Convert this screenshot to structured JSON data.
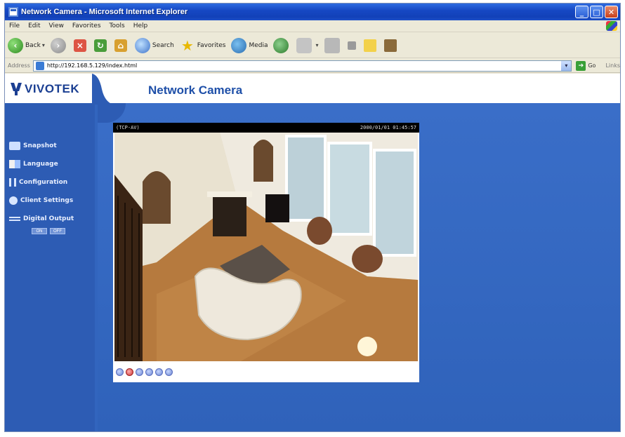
{
  "window": {
    "title": "Network Camera - Microsoft Internet Explorer",
    "buttons": [
      "minimize-button",
      "maximize-button",
      "close-button"
    ]
  },
  "menubar": {
    "items": [
      "File",
      "Edit",
      "View",
      "Favorites",
      "Tools",
      "Help"
    ]
  },
  "toolbar": {
    "back_label": "Back",
    "search_label": "Search",
    "favorites_label": "Favorites",
    "media_label": "Media"
  },
  "addressbar": {
    "label": "Address",
    "url": "http://192.168.5.129/index.html",
    "go_label": "Go",
    "links_label": "Links"
  },
  "page": {
    "logo": "VIVOTEK",
    "title": "Network Camera"
  },
  "sidebar": {
    "items": [
      {
        "label": "Snapshot",
        "icon": "camera-icon"
      },
      {
        "label": "Language",
        "icon": "language-icon"
      },
      {
        "label": "Configuration",
        "icon": "configuration-icon"
      },
      {
        "label": "Client Settings",
        "icon": "client-settings-icon"
      },
      {
        "label": "Digital Output",
        "icon": "digital-output-icon"
      }
    ],
    "digital_output_buttons": [
      "ON",
      "OFF"
    ]
  },
  "viewer": {
    "protocol": "(TCP-AV)",
    "timestamp": "2000/01/01 01:45:57",
    "controls": [
      "zoom-icon",
      "record-icon",
      "pause-icon",
      "stop-icon",
      "volume-icon",
      "microphone-icon"
    ]
  }
}
